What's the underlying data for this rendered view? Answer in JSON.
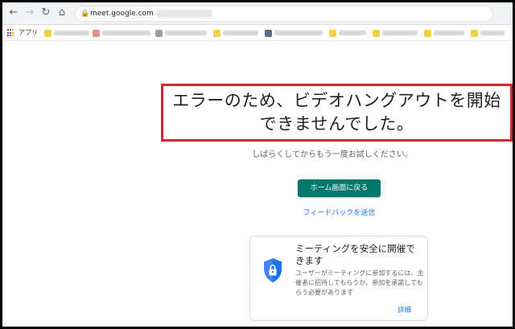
{
  "browser": {
    "url": "meet.google.com",
    "bookmarks_apps_label": "アプリ"
  },
  "error": {
    "title": "エラーのため、ビデオハングアウトを開始\nできませんでした。",
    "retry_text": "しばらくしてからもう一度お試しください。",
    "home_button": "ホーム画面に戻る",
    "feedback_link": "フィードバックを送信"
  },
  "info_card": {
    "title": "ミーティングを安全に開催できます",
    "text": "ユーザーがミーティングに参加するには、主催者に招待してもらうか、参加を承諾してもらう必要があります",
    "details_link": "詳細",
    "icon": "shield-lock-icon"
  },
  "colors": {
    "primary_button": "#00796b",
    "link": "#1a73e8",
    "highlight_box": "#d6272e"
  }
}
